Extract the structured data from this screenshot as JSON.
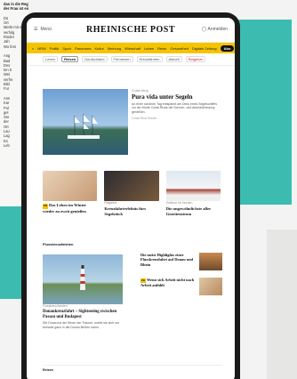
{
  "paper_column": {
    "lines": [
      "das in die Region weiter",
      "der Frau ist ein fest.",
      "",
      "Dü",
      "Ort",
      "Merkt mit neu",
      "verfolg",
      "Rinder",
      "Jah",
      "Wo fest",
      "",
      "Ang",
      "Bad",
      "Des",
      "ten b",
      "Wel",
      "verfre",
      "Bild",
      "Fur",
      "",
      "Ann",
      "Kar",
      "Pol",
      "gel",
      "Sto",
      "der",
      "Ort",
      "Lau",
      "Lag",
      "Es",
      "Leb"
    ]
  },
  "header": {
    "menu_label": "Menü",
    "logo": "RHEINISCHE POST",
    "login_label": "Anmelden"
  },
  "nav": {
    "items": [
      "NRW",
      "Politik",
      "Sport",
      "Panorama",
      "Kultur",
      "Meinung",
      "Wirtschaft",
      "Leben",
      "Reise",
      "Gesundheit",
      "Digitale Zeitung"
    ],
    "abo_label": "Abo"
  },
  "subnav": {
    "items": [
      "Leben",
      "Reisen",
      "Deutschland",
      "Fernreisen",
      "Kreuzfahrten",
      "Aktuell",
      "Ratgeber"
    ],
    "active": "Reisen"
  },
  "hero": {
    "kicker": "Cruise Ahoy",
    "title": "Pura vida unter Segeln",
    "body": "An einer schönen Tag entspannt am Deck eines Segelschiffes vor der Küste Costa Ricas die Sonnen- und Abendstimmung genießen.",
    "more": "Costa Rica Deluxe"
  },
  "cards": [
    {
      "kicker": "",
      "title": "Das Leben im Winter wieder zu zweit genießen",
      "badge": "PR"
    },
    {
      "kicker": "Ratgeber",
      "title": "Kreuzfahrterlebnis fürs Segelstück",
      "badge": ""
    },
    {
      "kicker": "Outdoor im Norden",
      "title": "Die ungewöhnlichste aller Gezeitenstrom",
      "badge": ""
    }
  ],
  "section": {
    "title": "Flusskreuzfahrten"
  },
  "big_card": {
    "kicker": "Flusskreuzfahrten",
    "title": "Donaukreuzfahrt – Sightseeing zwischen Passau und Budapest",
    "body": "Die Donau ist der Strom der Träume, wobei sie sich nur beinahe ganz in die Donau fließen nahm.",
    "badge": "PR"
  },
  "side_items": [
    {
      "title": "Die meist Highlights einer Flusskreuzfahrt auf Donau und Rhein",
      "badge": ""
    },
    {
      "title": "Wenn sich Arbeit nicht nach Arbeit anfühlt",
      "badge": "PR"
    }
  ],
  "footer": {
    "label": "Reisen"
  },
  "colors": {
    "brand_yellow": "#f5c400",
    "teal": "#3cbcb1"
  }
}
